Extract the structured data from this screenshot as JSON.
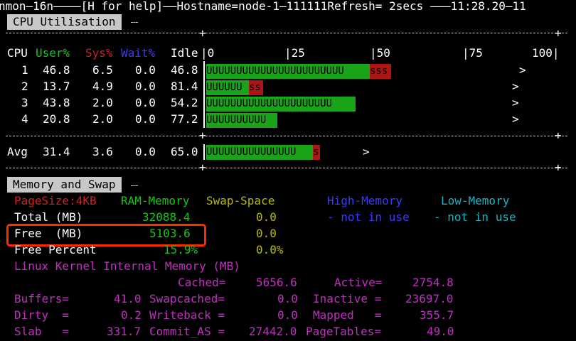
{
  "header": {
    "text": "nmon—16n————[H for help]——Hostname=node-1—111111Refresh= 2secs ———11:28.20—11"
  },
  "cpu": {
    "title": "CPU Utilisation",
    "cols": {
      "cpu": "CPU",
      "user": "User%",
      "sys": "Sys%",
      "wait": "Wait%",
      "idle": "Idle",
      "s0": "|0",
      "s25": "|25",
      "s50": "|50",
      "s75": "|75",
      "s100": "100|"
    },
    "rows": [
      {
        "cpu": "1",
        "user": "46.8",
        "sys": "6.5",
        "wait": "0.0",
        "idle": "46.8",
        "u_text": "UUUUUUUUUUUUUUUUUUUUUUU",
        "s_text": "sss",
        "marker": ">"
      },
      {
        "cpu": "2",
        "user": "13.7",
        "sys": "4.9",
        "wait": "0.0",
        "idle": "81.4",
        "u_text": "UUUUUU",
        "s_text": "ss",
        "marker": ">"
      },
      {
        "cpu": "3",
        "user": "43.8",
        "sys": "2.0",
        "wait": "0.0",
        "idle": "54.2",
        "u_text": "UUUUUUUUUUUUUUUUUUUUU",
        "s_text": "",
        "marker": ">"
      },
      {
        "cpu": "4",
        "user": "20.8",
        "sys": "2.0",
        "wait": "0.0",
        "idle": "77.2",
        "u_text": "UUUUUUUUUU",
        "s_text": "",
        "marker": ">"
      }
    ],
    "avg": {
      "label": "Avg",
      "user": "31.4",
      "sys": "3.6",
      "wait": "0.0",
      "idle": "65.0",
      "u_text": "UUUUUUUUUUUUUUU",
      "s_text": "s",
      "marker": ">"
    }
  },
  "memory": {
    "title": "Memory and Swap",
    "page_size": "PageSize:4KB",
    "ram_header": "RAM-Memory",
    "swap_header": "Swap-Space",
    "high_header": "High-Memory",
    "low_header": "Low-Memory",
    "total_label": "Total (MB)",
    "total_ram": "32088.4",
    "total_swap": "0.0",
    "high_status": "- not in use",
    "low_status": "- not in use",
    "free_label": "Free  (MB)",
    "free_ram": "5103.6",
    "free_swap": "0.0",
    "percent_label": "Free Percent",
    "percent_ram": "15.9%",
    "percent_swap": "0.0%",
    "kernel_title": "Linux Kernel Internal Memory (MB)",
    "cached_label": "Cached=",
    "cached_value": "5656.6",
    "active_label": "Active=",
    "active_value": "2754.8",
    "buffers_label": "Buffers=",
    "buffers_value": "41.0",
    "swapcached_label": "Swapcached=",
    "swapcached_value": "0.0",
    "inactive_label": "Inactive =",
    "inactive_value": "23697.0",
    "dirty_label": "Dirty  =",
    "dirty_value": "0.2",
    "writeback_label": "Writeback =",
    "writeback_value": "0.0",
    "mapped_label": "Mapped   =",
    "mapped_value": "355.7",
    "slab_label": "Slab   =",
    "slab_value": "331.7",
    "commit_label": "Commit_AS =",
    "commit_value": "27442.0",
    "pagetables_label": "PageTables=",
    "pagetables_value": "49.0"
  },
  "colors": {
    "user": "#19a319",
    "sys": "#b01515",
    "wait": "#3a3aff",
    "yellow": "#b8b800",
    "green": "#19c219",
    "magenta": "#c030c0",
    "red_label": "#d02020",
    "blue": "#3a3aff",
    "cyan": "#20b0c0",
    "highlight": "#ff2a00"
  }
}
